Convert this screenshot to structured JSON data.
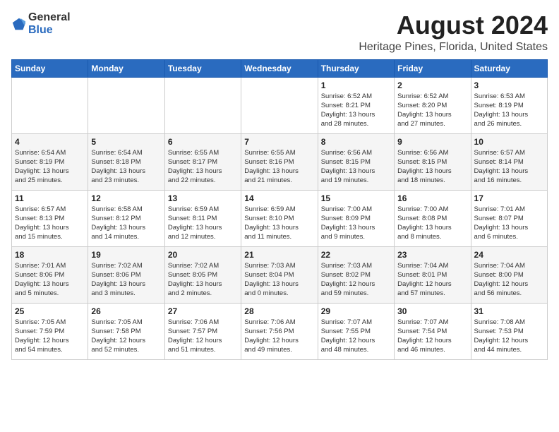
{
  "logo": {
    "general": "General",
    "blue": "Blue"
  },
  "title": "August 2024",
  "subtitle": "Heritage Pines, Florida, United States",
  "days_of_week": [
    "Sunday",
    "Monday",
    "Tuesday",
    "Wednesday",
    "Thursday",
    "Friday",
    "Saturday"
  ],
  "weeks": [
    [
      {
        "day": "",
        "info": ""
      },
      {
        "day": "",
        "info": ""
      },
      {
        "day": "",
        "info": ""
      },
      {
        "day": "",
        "info": ""
      },
      {
        "day": "1",
        "info": "Sunrise: 6:52 AM\nSunset: 8:21 PM\nDaylight: 13 hours\nand 28 minutes."
      },
      {
        "day": "2",
        "info": "Sunrise: 6:52 AM\nSunset: 8:20 PM\nDaylight: 13 hours\nand 27 minutes."
      },
      {
        "day": "3",
        "info": "Sunrise: 6:53 AM\nSunset: 8:19 PM\nDaylight: 13 hours\nand 26 minutes."
      }
    ],
    [
      {
        "day": "4",
        "info": "Sunrise: 6:54 AM\nSunset: 8:19 PM\nDaylight: 13 hours\nand 25 minutes."
      },
      {
        "day": "5",
        "info": "Sunrise: 6:54 AM\nSunset: 8:18 PM\nDaylight: 13 hours\nand 23 minutes."
      },
      {
        "day": "6",
        "info": "Sunrise: 6:55 AM\nSunset: 8:17 PM\nDaylight: 13 hours\nand 22 minutes."
      },
      {
        "day": "7",
        "info": "Sunrise: 6:55 AM\nSunset: 8:16 PM\nDaylight: 13 hours\nand 21 minutes."
      },
      {
        "day": "8",
        "info": "Sunrise: 6:56 AM\nSunset: 8:15 PM\nDaylight: 13 hours\nand 19 minutes."
      },
      {
        "day": "9",
        "info": "Sunrise: 6:56 AM\nSunset: 8:15 PM\nDaylight: 13 hours\nand 18 minutes."
      },
      {
        "day": "10",
        "info": "Sunrise: 6:57 AM\nSunset: 8:14 PM\nDaylight: 13 hours\nand 16 minutes."
      }
    ],
    [
      {
        "day": "11",
        "info": "Sunrise: 6:57 AM\nSunset: 8:13 PM\nDaylight: 13 hours\nand 15 minutes."
      },
      {
        "day": "12",
        "info": "Sunrise: 6:58 AM\nSunset: 8:12 PM\nDaylight: 13 hours\nand 14 minutes."
      },
      {
        "day": "13",
        "info": "Sunrise: 6:59 AM\nSunset: 8:11 PM\nDaylight: 13 hours\nand 12 minutes."
      },
      {
        "day": "14",
        "info": "Sunrise: 6:59 AM\nSunset: 8:10 PM\nDaylight: 13 hours\nand 11 minutes."
      },
      {
        "day": "15",
        "info": "Sunrise: 7:00 AM\nSunset: 8:09 PM\nDaylight: 13 hours\nand 9 minutes."
      },
      {
        "day": "16",
        "info": "Sunrise: 7:00 AM\nSunset: 8:08 PM\nDaylight: 13 hours\nand 8 minutes."
      },
      {
        "day": "17",
        "info": "Sunrise: 7:01 AM\nSunset: 8:07 PM\nDaylight: 13 hours\nand 6 minutes."
      }
    ],
    [
      {
        "day": "18",
        "info": "Sunrise: 7:01 AM\nSunset: 8:06 PM\nDaylight: 13 hours\nand 5 minutes."
      },
      {
        "day": "19",
        "info": "Sunrise: 7:02 AM\nSunset: 8:06 PM\nDaylight: 13 hours\nand 3 minutes."
      },
      {
        "day": "20",
        "info": "Sunrise: 7:02 AM\nSunset: 8:05 PM\nDaylight: 13 hours\nand 2 minutes."
      },
      {
        "day": "21",
        "info": "Sunrise: 7:03 AM\nSunset: 8:04 PM\nDaylight: 13 hours\nand 0 minutes."
      },
      {
        "day": "22",
        "info": "Sunrise: 7:03 AM\nSunset: 8:02 PM\nDaylight: 12 hours\nand 59 minutes."
      },
      {
        "day": "23",
        "info": "Sunrise: 7:04 AM\nSunset: 8:01 PM\nDaylight: 12 hours\nand 57 minutes."
      },
      {
        "day": "24",
        "info": "Sunrise: 7:04 AM\nSunset: 8:00 PM\nDaylight: 12 hours\nand 56 minutes."
      }
    ],
    [
      {
        "day": "25",
        "info": "Sunrise: 7:05 AM\nSunset: 7:59 PM\nDaylight: 12 hours\nand 54 minutes."
      },
      {
        "day": "26",
        "info": "Sunrise: 7:05 AM\nSunset: 7:58 PM\nDaylight: 12 hours\nand 52 minutes."
      },
      {
        "day": "27",
        "info": "Sunrise: 7:06 AM\nSunset: 7:57 PM\nDaylight: 12 hours\nand 51 minutes."
      },
      {
        "day": "28",
        "info": "Sunrise: 7:06 AM\nSunset: 7:56 PM\nDaylight: 12 hours\nand 49 minutes."
      },
      {
        "day": "29",
        "info": "Sunrise: 7:07 AM\nSunset: 7:55 PM\nDaylight: 12 hours\nand 48 minutes."
      },
      {
        "day": "30",
        "info": "Sunrise: 7:07 AM\nSunset: 7:54 PM\nDaylight: 12 hours\nand 46 minutes."
      },
      {
        "day": "31",
        "info": "Sunrise: 7:08 AM\nSunset: 7:53 PM\nDaylight: 12 hours\nand 44 minutes."
      }
    ]
  ]
}
